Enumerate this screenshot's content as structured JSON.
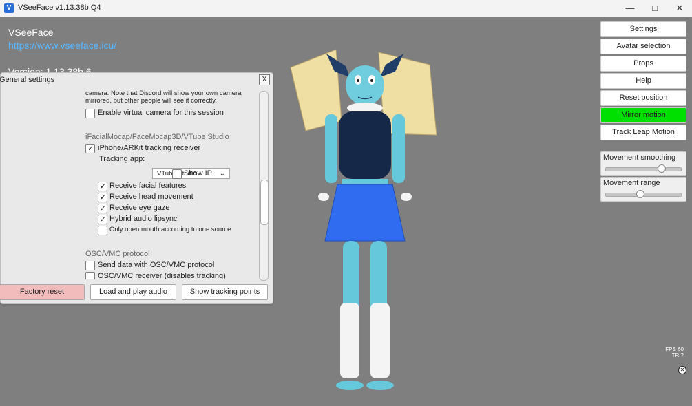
{
  "window": {
    "title": "VSeeFace v1.13.38b Q4",
    "buttons": [
      "—",
      "□",
      "✕"
    ]
  },
  "overlay": {
    "brand": "VSeeFace",
    "link": "https://www.vseeface.icu/",
    "version": "Version: 1.13.38b 6"
  },
  "general": {
    "title": "General settings",
    "close": "X",
    "note_line1": "camera. Note that Discord will show your own camera",
    "note_line2": "mirrored, but other people will see it correctly.",
    "virtual_camera": "Enable virtual camera for this session",
    "section1": "iFacialMocap/FaceMocap3D/VTube Studio",
    "ios_receiver": "iPhone/ARKit tracking receiver",
    "tracking_app_label": "Tracking app:",
    "tracking_app_value": "VTube Studio",
    "show_ip": "Show IP",
    "receive_facial": "Receive facial features",
    "receive_head": "Receive head movement",
    "receive_eye": "Receive eye gaze",
    "hybrid_audio": "Hybrid audio lipsync",
    "open_mouth": "Only open mouth according to one source",
    "section2": "OSC/VMC protocol",
    "send_data": "Send data with OSC/VMC protocol",
    "vmc_receiver": "OSC/VMC receiver (disables tracking)",
    "factory_reset": "Factory reset",
    "load_audio": "Load and play audio",
    "tracking_points": "Show tracking points"
  },
  "right_panel": {
    "settings": "Settings",
    "avatar_selection": "Avatar selection",
    "props": "Props",
    "help": "Help",
    "reset_position": "Reset position",
    "mirror_motion": "Mirror motion",
    "track_leap": "Track Leap Motion",
    "movement_smoothing": "Movement smoothing",
    "movement_range": "Movement range",
    "movement_smoothing_value": 0.73,
    "movement_range_value": 0.45
  },
  "status": {
    "fps_label": "FPS",
    "fps_value": "60",
    "tr": "TR",
    "q": "?"
  },
  "colors": {
    "mirror_motion": "#00e000",
    "factory_reset": "#f3bcbc",
    "link": "#58b7ff"
  }
}
